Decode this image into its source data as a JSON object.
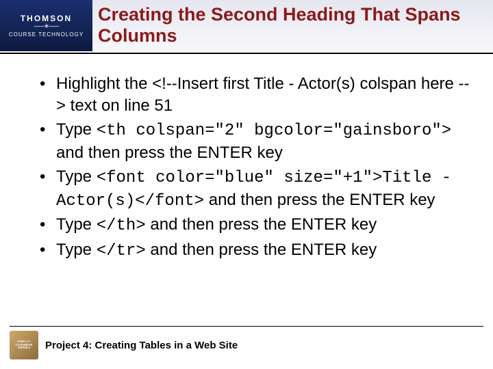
{
  "logo": {
    "top": "THOMSON",
    "star": "──✶──",
    "bottom": "COURSE TECHNOLOGY"
  },
  "title": "Creating the Second Heading That Spans Columns",
  "bullets": [
    {
      "pre": "Highlight the <!--Insert first Title - Actor(s) colspan here --> text on line 51"
    },
    {
      "pre": "Type ",
      "code": "<th colspan=\"2\" bgcolor=\"gainsboro\">",
      "post": " and then press the ENTER key"
    },
    {
      "pre": "Type ",
      "code": "<font color=\"blue\" size=\"+1\">Title - Actor(s)</font>",
      "post": " and then press the ENTER key"
    },
    {
      "pre": "Type ",
      "code": "</th>",
      "post": " and then press the ENTER key"
    },
    {
      "pre": "Type ",
      "code": "</tr>",
      "post": " and then press the ENTER key"
    }
  ],
  "footer": {
    "logo_lines": [
      "SHELLY",
      "CASHMAN",
      "SERIES"
    ],
    "text": "Project 4: Creating Tables in a Web Site"
  }
}
